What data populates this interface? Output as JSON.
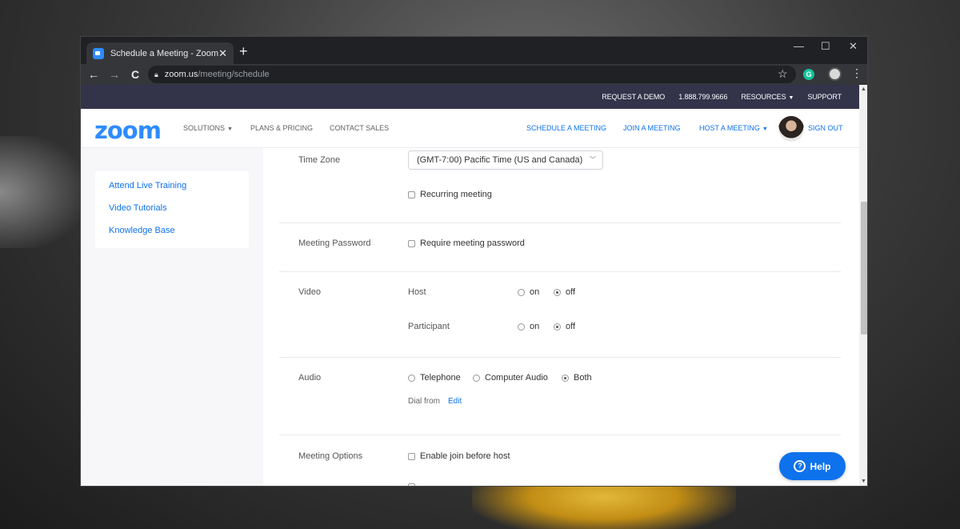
{
  "browser": {
    "tab_title": "Schedule a Meeting - Zoom",
    "tab_close": "✕",
    "new_tab": "+",
    "url_host": "zoom.us",
    "url_path": "/meeting/schedule",
    "back": "←",
    "forward": "→",
    "reload": "C",
    "star": "☆",
    "ext_letter": "G",
    "menu": "⋮",
    "minimize": "—",
    "maximize": "☐",
    "close": "✕"
  },
  "topbar": {
    "request_demo": "REQUEST A DEMO",
    "phone": "1.888.799.9666",
    "resources": "RESOURCES",
    "support": "SUPPORT"
  },
  "nav": {
    "logo": "zoom",
    "solutions": "SOLUTIONS",
    "plans": "PLANS & PRICING",
    "contact": "CONTACT SALES",
    "schedule": "SCHEDULE A MEETING",
    "join": "JOIN A MEETING",
    "host": "HOST A MEETING",
    "signout": "SIGN OUT"
  },
  "sidebar": {
    "items": [
      "Attend Live Training",
      "Video Tutorials",
      "Knowledge Base"
    ]
  },
  "form": {
    "timezone_label": "Time Zone",
    "timezone_value": "(GMT-7:00) Pacific Time (US and Canada)",
    "recurring": "Recurring meeting",
    "password_label": "Meeting Password",
    "password_option": "Require meeting password",
    "video_label": "Video",
    "host": "Host",
    "participant": "Participant",
    "on": "on",
    "off": "off",
    "audio_label": "Audio",
    "telephone": "Telephone",
    "computer_audio": "Computer Audio",
    "both": "Both",
    "dial_from": "Dial from",
    "edit": "Edit",
    "options_label": "Meeting Options",
    "join_before_host": "Enable join before host"
  },
  "help": {
    "label": "Help",
    "icon": "?"
  },
  "state": {
    "video_host": "off",
    "video_participant": "off",
    "audio": "Both",
    "recurring": false,
    "require_password": false,
    "join_before_host": false
  },
  "colors": {
    "accent": "#0e72ed",
    "logo": "#2d8cff",
    "topbar": "#33334a"
  }
}
